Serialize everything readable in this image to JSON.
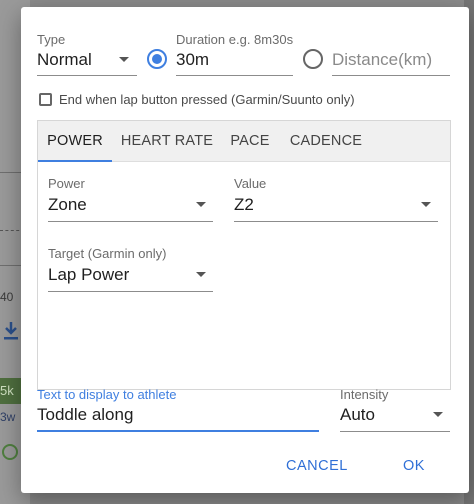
{
  "background": {
    "axis_value": "40",
    "chip_text": "5k",
    "side_text": "3w"
  },
  "dialog": {
    "type": {
      "label": "Type",
      "value": "Normal"
    },
    "duration": {
      "label": "Duration e.g. 8m30s",
      "value": "30m",
      "selected": true
    },
    "distance": {
      "placeholder": "Distance(km)",
      "selected": false
    },
    "lap_checkbox": {
      "label": "End when lap button pressed (Garmin/Suunto only)",
      "checked": false
    },
    "tabs": [
      {
        "label": "POWER",
        "active": true
      },
      {
        "label": "HEART RATE",
        "active": false
      },
      {
        "label": "PACE",
        "active": false
      },
      {
        "label": "CADENCE",
        "active": false
      }
    ],
    "power": {
      "label": "Power",
      "value": "Zone"
    },
    "value": {
      "label": "Value",
      "value": "Z2"
    },
    "target": {
      "label": "Target (Garmin only)",
      "value": "Lap Power"
    },
    "athlete_text": {
      "label": "Text to display to athlete",
      "value": "Toddle along"
    },
    "intensity": {
      "label": "Intensity",
      "value": "Auto"
    },
    "actions": {
      "cancel": "CANCEL",
      "ok": "OK"
    }
  },
  "colors": {
    "accent": "#3f7fe0",
    "button_text": "#2f6fd6",
    "tab_bar": "#f0f0f0"
  }
}
